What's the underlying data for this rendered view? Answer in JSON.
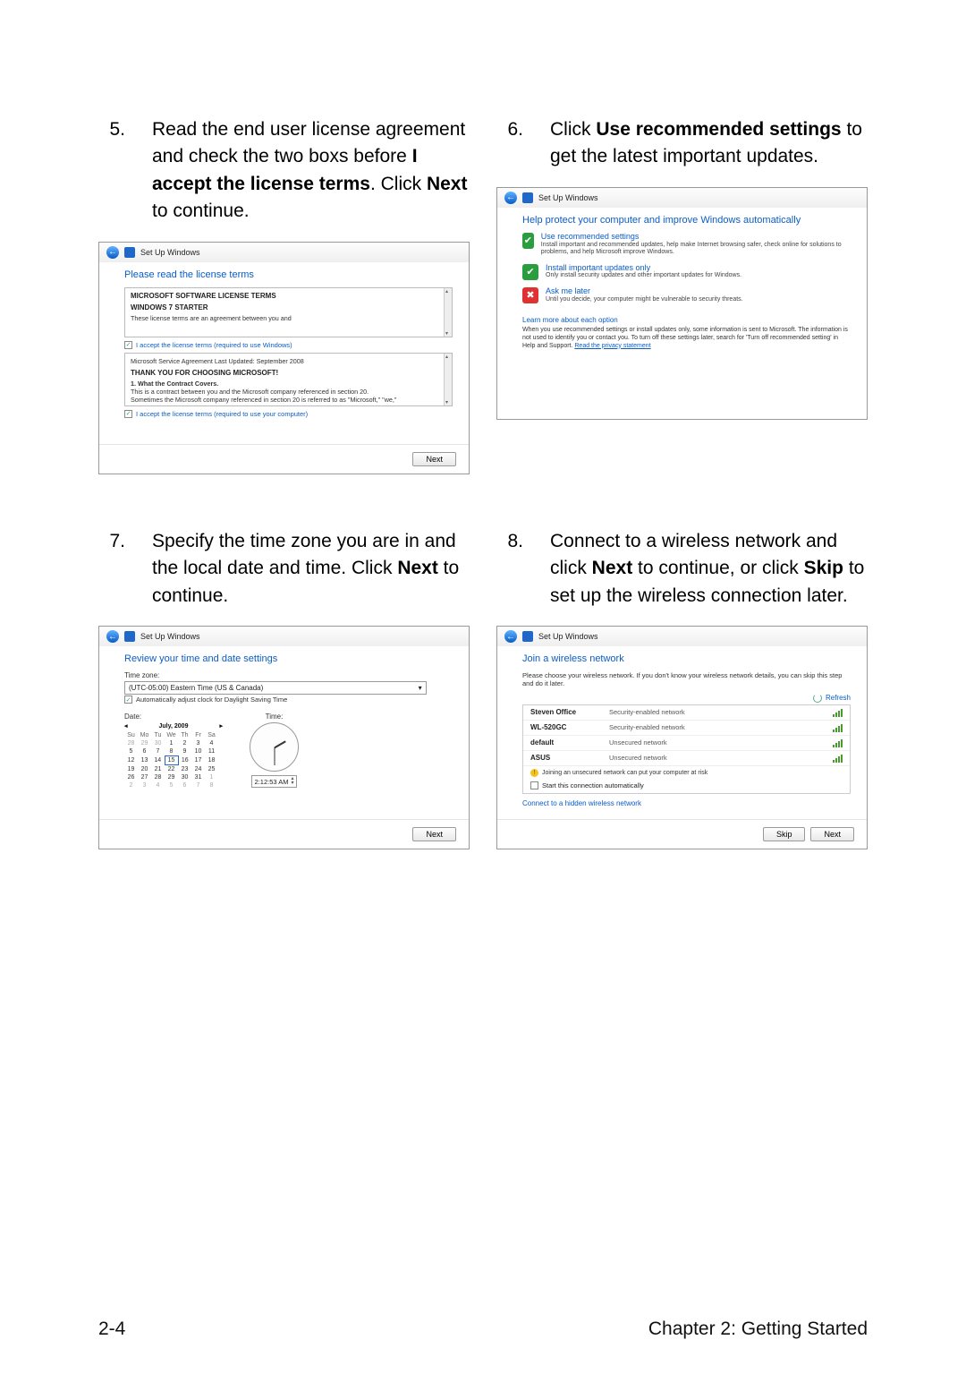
{
  "steps": {
    "s5": {
      "num": "5.",
      "text_a": "Read the end user license agreement and check the two boxs before ",
      "bold_a": "I accept the license terms",
      "text_b": ". Click ",
      "bold_b": "Next",
      "text_c": " to continue."
    },
    "s6": {
      "num": "6.",
      "text_a": "Click ",
      "bold_a": "Use recommended settings",
      "text_b": " to get the latest important updates."
    },
    "s7": {
      "num": "7.",
      "text_a": "Specify the time zone you are in and the local date and time. Click ",
      "bold_a": "Next",
      "text_b": " to continue."
    },
    "s8": {
      "num": "8.",
      "text_a": "Connect to a wireless network and click ",
      "bold_a": "Next",
      "text_b": " to continue, or click ",
      "bold_b": "Skip",
      "text_c": " to set up the wireless connection later."
    }
  },
  "wizard_title": "Set Up Windows",
  "buttons": {
    "next": "Next",
    "skip": "Skip"
  },
  "step5_dialog": {
    "heading": "Please read the license terms",
    "box1_title": "MICROSOFT SOFTWARE LICENSE TERMS",
    "box1_sub": "WINDOWS 7 STARTER",
    "box1_line": "These license terms are an agreement between you and",
    "accept1": "I accept the license terms (required to use Windows)",
    "box2_line1": "Microsoft Service Agreement Last Updated: September 2008",
    "box2_line2": "THANK YOU FOR CHOOSING MICROSOFT!",
    "box2_line3": "1. What the Contract Covers.",
    "box2_line4": "This is a contract between you and the Microsoft company referenced in section 20.",
    "box2_line5": "Sometimes the Microsoft company referenced in section 20 is referred to as \"Microsoft,\" \"we,\"",
    "accept2": "I accept the license terms (required to use your computer)"
  },
  "step6_dialog": {
    "heading": "Help protect your computer and improve Windows automatically",
    "opt1_title": "Use recommended settings",
    "opt1_desc": "Install important and recommended updates, help make Internet browsing safer, check online for solutions to problems, and help Microsoft improve Windows.",
    "opt2_title": "Install important updates only",
    "opt2_desc": "Only install security updates and other important updates for Windows.",
    "opt3_title": "Ask me later",
    "opt3_desc": "Until you decide, your computer might be vulnerable to security threats.",
    "learn": "Learn more about each option",
    "note": "When you use recommended settings or install updates only, some information is sent to Microsoft. The information is not used to identify you or contact you. To turn off these settings later, search for 'Turn off recommended setting' in Help and Support. ",
    "note_link": "Read the privacy statement"
  },
  "step7_dialog": {
    "heading": "Review your time and date settings",
    "tz_label": "Time zone:",
    "tz_value": "(UTC-05:00) Eastern Time (US & Canada)",
    "dst": "Automatically adjust clock for Daylight Saving Time",
    "date_label": "Date:",
    "time_label": "Time:",
    "month": "July, 2009",
    "dow": [
      "Su",
      "Mo",
      "Tu",
      "We",
      "Th",
      "Fr",
      "Sa"
    ],
    "weeks": [
      [
        "28",
        "29",
        "30",
        "1",
        "2",
        "3",
        "4"
      ],
      [
        "5",
        "6",
        "7",
        "8",
        "9",
        "10",
        "11"
      ],
      [
        "12",
        "13",
        "14",
        "15",
        "16",
        "17",
        "18"
      ],
      [
        "19",
        "20",
        "21",
        "22",
        "23",
        "24",
        "25"
      ],
      [
        "26",
        "27",
        "28",
        "29",
        "30",
        "31",
        "1"
      ],
      [
        "2",
        "3",
        "4",
        "5",
        "6",
        "7",
        "8"
      ]
    ],
    "selected_day": "15",
    "time_value": "2:12:53 AM"
  },
  "step8_dialog": {
    "heading": "Join a wireless network",
    "intro": "Please choose your wireless network. If you don't know your wireless network details, you can skip this step and do it later.",
    "refresh": "Refresh",
    "nets": [
      {
        "name": "Steven Office",
        "type": "Security-enabled network"
      },
      {
        "name": "WL-520GC",
        "type": "Security-enabled network"
      },
      {
        "name": "default",
        "type": "Unsecured network"
      },
      {
        "name": "ASUS",
        "type": "Unsecured network"
      }
    ],
    "warn": "Joining an unsecured network can put your computer at risk",
    "auto": "Start this connection automatically",
    "hidden": "Connect to a hidden wireless network"
  },
  "footer": {
    "left": "2-4",
    "right": "Chapter 2: Getting Started"
  }
}
